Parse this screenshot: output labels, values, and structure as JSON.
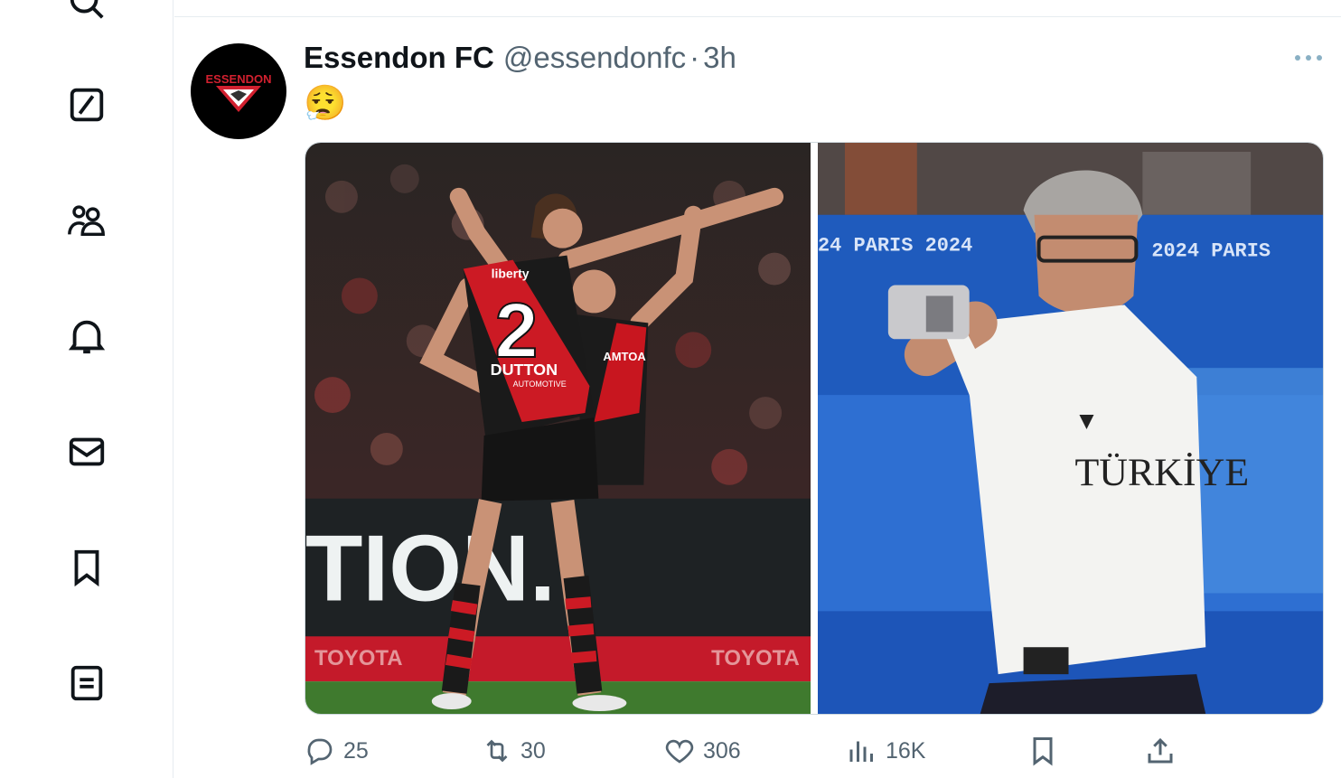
{
  "sidebar": {
    "items": [
      {
        "icon": "search-icon"
      },
      {
        "icon": "grok-icon"
      },
      {
        "icon": "communities-icon"
      },
      {
        "icon": "bell-icon"
      },
      {
        "icon": "mail-icon"
      },
      {
        "icon": "bookmark-icon"
      },
      {
        "icon": "lists-icon"
      }
    ]
  },
  "tweet": {
    "display_name": "Essendon FC",
    "handle": "@essendonfc",
    "separator": "·",
    "time": "3h",
    "text": "😮‍💨",
    "avatar_logo_text": "ESSENDON",
    "photo_left": {
      "jersey_number": "2",
      "sponsor_top": "liberty",
      "sponsor_main": "DUTTON",
      "sponsor_sub": "AUTOMOTIVE",
      "banner_text": "TION.",
      "board_text_1": "TOYOTA",
      "board_text_2": "TOYOTA",
      "teammate_sponsor": "AMTOA"
    },
    "photo_right": {
      "wall_text_1": "24  PARIS 2024",
      "wall_text_2": "2024  PARIS",
      "shirt_text": "TÜRKİYE"
    },
    "metrics": {
      "replies": "25",
      "reposts": "30",
      "likes": "306",
      "views": "16K"
    }
  },
  "colors": {
    "icon": "#0f1419",
    "secondary": "#536471",
    "essendon_red": "#d2202f",
    "divider": "#e6ecf0"
  }
}
